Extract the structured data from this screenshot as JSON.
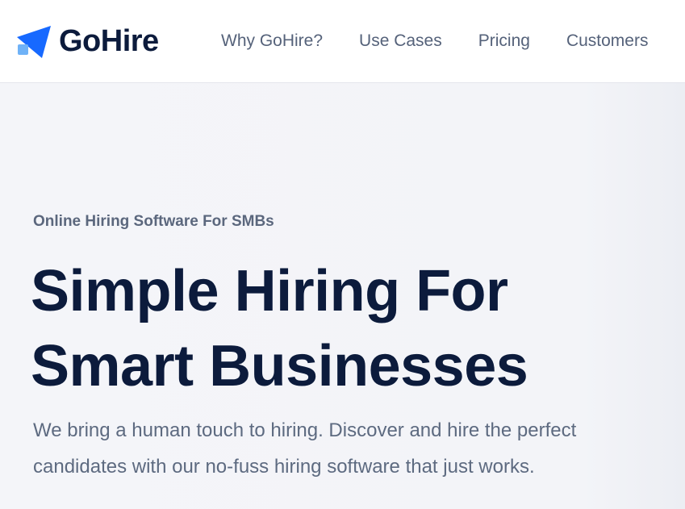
{
  "brand": {
    "name": "GoHire",
    "logo_icon": "paper-plane-icon",
    "colors": {
      "primary": "#1769ff",
      "accent_light": "#6fb2f7",
      "heading": "#0c1b3c",
      "body_text": "#5d6a80"
    }
  },
  "nav": {
    "items": [
      {
        "label": "Why GoHire?"
      },
      {
        "label": "Use Cases"
      },
      {
        "label": "Pricing"
      },
      {
        "label": "Customers"
      }
    ]
  },
  "hero": {
    "eyebrow": "Online Hiring Software For SMBs",
    "headline_line1": "Simple Hiring For",
    "headline_line2": "Smart Businesses",
    "subtext": "We bring a human touch to hiring. Discover and hire the perfect candidates with our no-fuss hiring software that just works."
  }
}
